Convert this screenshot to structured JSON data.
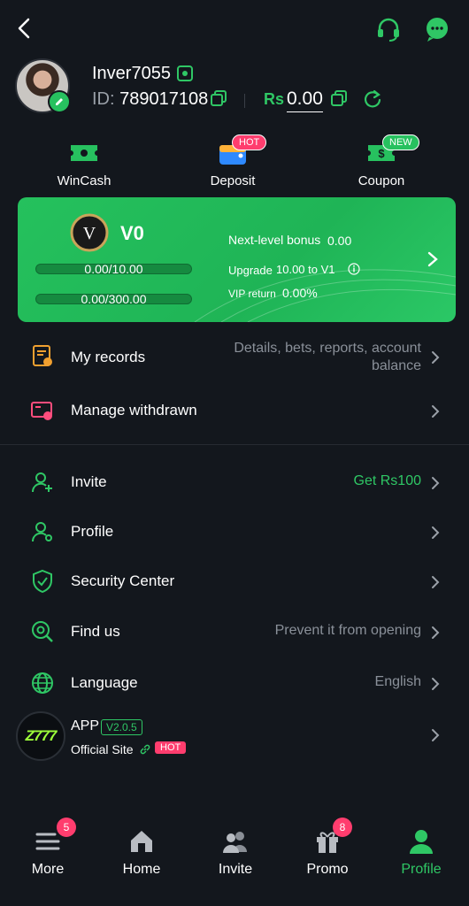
{
  "profile": {
    "username": "Inver7055",
    "id_label": "ID:",
    "id_value": "789017108",
    "currency": "Rs",
    "balance": "0.00"
  },
  "quick_actions": [
    {
      "label": "WinCash",
      "icon": "ticket-icon"
    },
    {
      "label": "Deposit",
      "icon": "wallet-icon",
      "badge": "HOT"
    },
    {
      "label": "Coupon",
      "icon": "coupon-icon",
      "badge": "NEW"
    }
  ],
  "vip": {
    "level": "V0",
    "progress1": "0.00/10.00",
    "progress1_fraction": 0,
    "progress2": "0.00/300.00",
    "progress2_fraction": 0,
    "next_bonus_label": "Next-level bonus",
    "next_bonus_value": "0.00",
    "upgrade_label": "Upgrade",
    "upgrade_value": "10.00 to V1",
    "return_label": "VIP return",
    "return_value": "0.00%"
  },
  "menu": [
    {
      "label": "My records",
      "value": "Details, bets, reports, account balance",
      "icon": "records-icon"
    },
    {
      "label": "Manage withdrawn",
      "value": "",
      "icon": "withdraw-icon"
    },
    {
      "label": "Invite",
      "value": "Get Rs100",
      "icon": "invite-icon"
    },
    {
      "label": "Profile",
      "value": "",
      "icon": "profile-icon"
    },
    {
      "label": "Security Center",
      "value": "",
      "icon": "shield-icon"
    },
    {
      "label": "Find us",
      "value": "Prevent it from opening",
      "icon": "find-icon"
    },
    {
      "label": "Language",
      "value": "English",
      "icon": "globe-icon"
    }
  ],
  "app": {
    "logo_text": "Z777",
    "title": "APP",
    "version": "V2.0.5",
    "site": "Official Site",
    "hot": "HOT"
  },
  "nav": [
    {
      "label": "More",
      "count": "5"
    },
    {
      "label": "Home"
    },
    {
      "label": "Invite"
    },
    {
      "label": "Promo",
      "count": "8"
    },
    {
      "label": "Profile"
    }
  ],
  "colors": {
    "accent": "#2fc765",
    "background": "#13171d",
    "hot": "#ff3d6e"
  }
}
